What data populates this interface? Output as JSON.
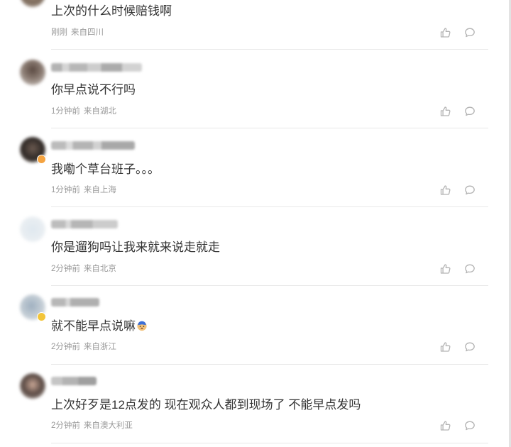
{
  "comments": [
    {
      "text": "上次的什么时候赔钱啊",
      "time": "刚刚",
      "location": "来自四川"
    },
    {
      "text": "你早点说不行吗",
      "time": "1分钟前",
      "location": "来自湖北"
    },
    {
      "text": "我嘞个草台班子。。。",
      "time": "1分钟前",
      "location": "来自上海"
    },
    {
      "text": "你是遛狗吗让我来就来说走就走",
      "time": "2分钟前",
      "location": "来自北京"
    },
    {
      "text": "就不能早点说嘛",
      "emoji": "doge-emoji",
      "time": "2分钟前",
      "location": "来自浙江"
    },
    {
      "text": "上次好歹是12点发的 现在观众人都到现场了 不能早点发吗",
      "time": "2分钟前",
      "location": "来自澳大利亚"
    }
  ],
  "icons": {
    "like": "thumbs-up-icon",
    "reply": "speech-bubble-icon"
  },
  "colors": {
    "text": "#333333",
    "meta": "#999999",
    "icon": "#b3b3b3",
    "divider": "#e8e8e8"
  }
}
